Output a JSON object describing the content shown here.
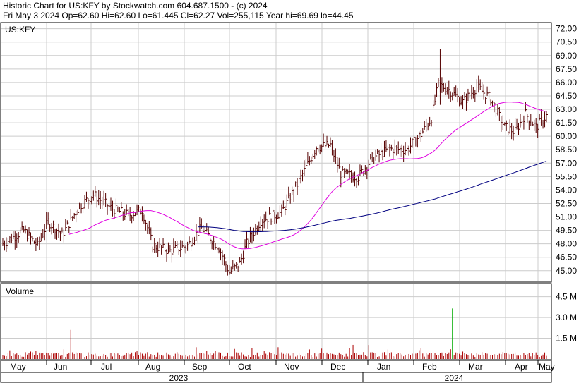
{
  "header": {
    "title": "Historic Chart for US:KFY by Stockwatch.com 604.687.1500 - (c) 2024",
    "quote": "Fri May  3 2024  Op=62.60  Hi=62.60  Lo=61.445  Cl=62.27  Vol=255,115  Year hi=69.69  lo=44.45"
  },
  "chart_data": {
    "type": "line",
    "symbol_label": "US:KFY",
    "volume_label": "Volume",
    "price_axis": {
      "ticks": [
        "45.00",
        "46.50",
        "48.00",
        "49.50",
        "51.00",
        "52.50",
        "54.00",
        "55.50",
        "57.00",
        "58.50",
        "60.00",
        "61.50",
        "63.00",
        "64.50",
        "66.00",
        "67.50",
        "69.00",
        "70.50",
        "72.00"
      ],
      "ylim": [
        43.8,
        72.6
      ]
    },
    "volume_axis": {
      "ticks": [
        "1.5 M",
        "3.0 M",
        "4.5 M"
      ],
      "ylim": [
        0,
        5.4
      ]
    },
    "months": [
      "May",
      "Jun",
      "Jul",
      "Aug",
      "Sep",
      "Oct",
      "Nov",
      "Dec",
      "Jan",
      "Feb",
      "Mar",
      "Apr",
      "May"
    ],
    "years": [
      "2023",
      "2024"
    ],
    "grid": true,
    "colors": {
      "bars": "#550000",
      "ma_short": "#e000e0",
      "ma_long": "#000080",
      "volume": "#aa0000",
      "volume_spike": "#00aa00",
      "grid": "#cccccc"
    },
    "price_series": [
      {
        "month": "May 2023",
        "close": 48.2
      },
      {
        "month": "Jun 2023",
        "close": 50.5
      },
      {
        "month": "Jul 2023",
        "close": 53.5
      },
      {
        "month": "Aug 2023",
        "close": 51.8
      },
      {
        "month": "Sep 2023",
        "close": 47.3
      },
      {
        "month": "Oct 2023",
        "close": 48.2
      },
      {
        "month": "Nov 2023",
        "close": 50.8
      },
      {
        "month": "Dec 2023",
        "close": 58.8
      },
      {
        "month": "Jan 2024",
        "close": 56.0
      },
      {
        "month": "Feb 2024",
        "close": 59.0
      },
      {
        "month": "Mar 2024",
        "close": 64.0
      },
      {
        "month": "Apr 2024",
        "close": 61.0
      },
      {
        "month": "May 2024",
        "close": 62.27
      }
    ]
  }
}
